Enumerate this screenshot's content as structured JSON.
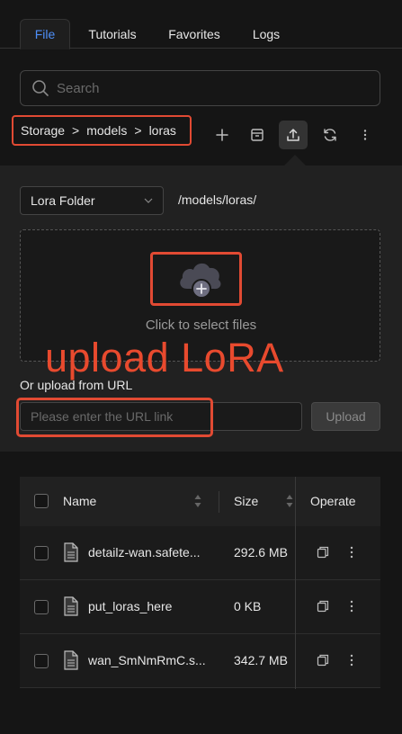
{
  "tabs": [
    {
      "label": "File",
      "active": true
    },
    {
      "label": "Tutorials",
      "active": false
    },
    {
      "label": "Favorites",
      "active": false
    },
    {
      "label": "Logs",
      "active": false
    }
  ],
  "search": {
    "placeholder": "Search"
  },
  "breadcrumb": {
    "items": [
      "Storage",
      "models",
      "loras"
    ],
    "separator": ">"
  },
  "toolbar": {
    "icons": [
      "plus-icon",
      "archive-icon",
      "upload-icon",
      "refresh-icon",
      "more-vertical-icon"
    ],
    "active": "upload-icon"
  },
  "upload_panel": {
    "folder_select_value": "Lora Folder",
    "folder_path": "/models/loras/",
    "dropzone_text": "Click to select files",
    "overlay_annotation": "upload LoRA",
    "url_label": "Or upload from URL",
    "url_placeholder": "Please enter the URL link",
    "upload_button_label": "Upload"
  },
  "table": {
    "columns": {
      "name": "Name",
      "size": "Size",
      "operate": "Operate"
    },
    "rows": [
      {
        "name": "detailz-wan.safete...",
        "size": "292.6 MB"
      },
      {
        "name": "put_loras_here",
        "size": "0 KB"
      },
      {
        "name": "wan_SmNmRmC.s...",
        "size": "342.7 MB"
      }
    ]
  },
  "colors": {
    "accent": "#4d8ef7",
    "highlight": "#e14a33",
    "background": "#151515"
  }
}
